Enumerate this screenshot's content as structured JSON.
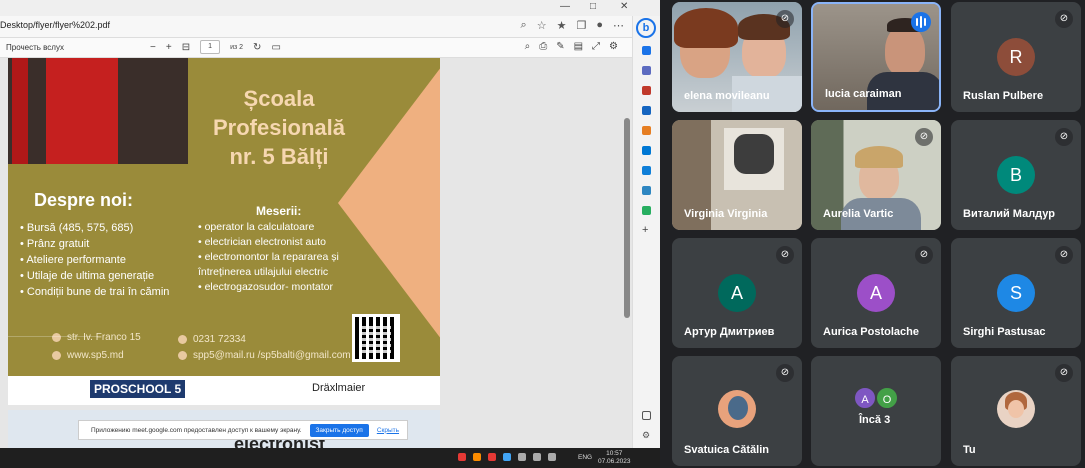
{
  "browser": {
    "url": "Desktop/flyer/flyer%202.pdf",
    "read_aloud": "Прочесть вслух",
    "page_current": "1",
    "page_total": "из 2"
  },
  "flyer": {
    "title_lines": [
      "Școala",
      "Profesională",
      "nr. 5 Bălți"
    ],
    "despre_heading": "Despre noi:",
    "despre_items": [
      "Bursă (485, 575, 685)",
      "Prânz gratuit",
      "Ateliere performante",
      "Utilaje de ultima generație",
      "Condiții bune de trai în cămin"
    ],
    "meserii_heading": "Meserii:",
    "meserii_items": [
      "operator la calculatoare",
      "electrician electronist auto",
      "electromontor la repararea și întreținerea utilajului electric",
      "electrogazosudor- montator"
    ],
    "address": "str. Iv. Franco 15",
    "website": "www.sp5.md",
    "phone": "0231 72334",
    "email": "spp5@mail.ru /sp5balti@gmail.com",
    "proschool": "PROSCHOOL 5",
    "draxlmaier": "Dräxlmaier",
    "page2_fragment": "electronist",
    "colors": {
      "olive": "#9a8b3a",
      "peach": "#efb080",
      "title": "#f6d7b0"
    }
  },
  "notice": {
    "text": "Приложению meet.google.com предоставлен доступ к вашему экрану.",
    "stop_button": "Закрыть доступ",
    "hide_link": "Скрыть"
  },
  "taskbar": {
    "lang": "ENG",
    "time": "10:57",
    "date": "07.06.2023"
  },
  "sidebar": {
    "bing_label": "b"
  },
  "participants": [
    {
      "name": "elena movileanu",
      "type": "video",
      "muted": true
    },
    {
      "name": "lucia caraiman",
      "type": "video",
      "speaking": true
    },
    {
      "name": "Ruslan Pulbere",
      "type": "avatar",
      "initial": "R",
      "color": "#8d4d3a",
      "muted": true
    },
    {
      "name": "Virginia Virginia",
      "type": "video",
      "muted": false
    },
    {
      "name": "Aurelia Vartic",
      "type": "video",
      "muted": true
    },
    {
      "name": "Виталий Малдур",
      "type": "avatar",
      "initial": "B",
      "color": "#00897b",
      "muted": true
    },
    {
      "name": "Артур Дмитриев",
      "type": "avatar",
      "initial": "A",
      "color": "#00695c",
      "muted": true
    },
    {
      "name": "Aurica Postolache",
      "type": "avatar",
      "initial": "A",
      "color": "#9c4fc8",
      "muted": true
    },
    {
      "name": "Sirghi Pastusac",
      "type": "avatar",
      "initial": "S",
      "color": "#1e88e5",
      "muted": true
    },
    {
      "name": "Svatuica Cătălin",
      "type": "picture",
      "muted": true
    },
    {
      "name": "Încă 3",
      "type": "more",
      "initials": [
        "A",
        "O"
      ],
      "colors": [
        "#7e57c2",
        "#43a047"
      ]
    },
    {
      "name": "Tu",
      "type": "picture",
      "muted": true
    }
  ],
  "icons": {
    "mute": "mic-off-icon",
    "speaking": "audio-bars-icon"
  }
}
